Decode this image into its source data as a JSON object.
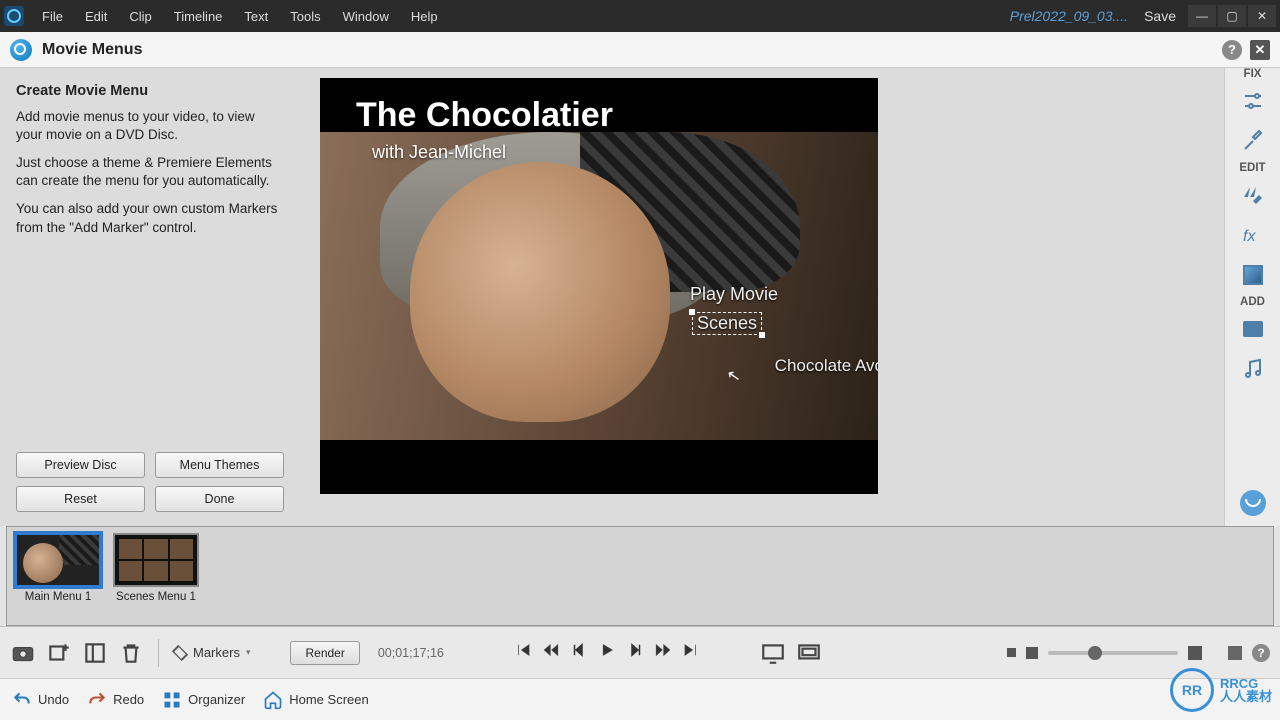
{
  "titlebar": {
    "menus": [
      "File",
      "Edit",
      "Clip",
      "Timeline",
      "Text",
      "Tools",
      "Window",
      "Help"
    ],
    "project": "Prel2022_09_03....",
    "save": "Save"
  },
  "panel": {
    "title": "Movie Menus"
  },
  "leftpane": {
    "heading": "Create Movie Menu",
    "p1": "Add movie menus to your video, to view your movie on a DVD Disc.",
    "p2": "Just choose a theme & Premiere Elements can create the menu for you automatically.",
    "p3": "You can also add your own custom Markers from the \"Add Marker\" control.",
    "btn_preview": "Preview Disc",
    "btn_themes": "Menu Themes",
    "btn_reset": "Reset",
    "btn_done": "Done"
  },
  "preview": {
    "title": "The Chocolatier",
    "subtitle": "with Jean-Michel",
    "play": "Play Movie",
    "scenes": "Scenes",
    "extra": "Chocolate Avo"
  },
  "rail": {
    "fix": "FIX",
    "edit": "EDIT",
    "add": "ADD"
  },
  "strip": {
    "thumbs": [
      {
        "caption": "Main Menu 1",
        "selected": true
      },
      {
        "caption": "Scenes Menu 1",
        "selected": false
      }
    ]
  },
  "toolbar": {
    "markers": "Markers",
    "render": "Render",
    "timecode": "00;01;17;16"
  },
  "bottombar": {
    "undo": "Undo",
    "redo": "Redo",
    "organizer": "Organizer",
    "home": "Home Screen"
  },
  "brand": {
    "ring": "RR",
    "txt": "RRCG\n人人素材"
  }
}
